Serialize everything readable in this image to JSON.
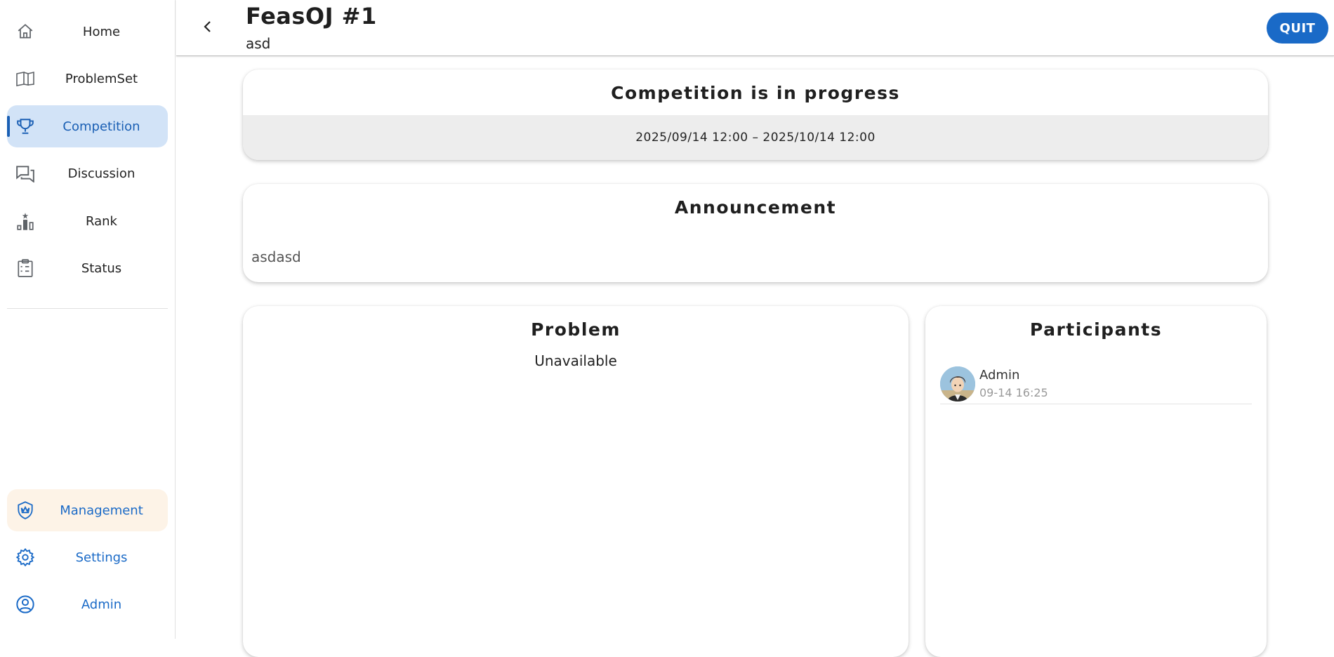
{
  "sidebar": {
    "items": [
      {
        "label": "Home",
        "icon": "home-icon"
      },
      {
        "label": "ProblemSet",
        "icon": "book-icon"
      },
      {
        "label": "Competition",
        "icon": "trophy-icon",
        "active": true
      },
      {
        "label": "Discussion",
        "icon": "forum-icon"
      },
      {
        "label": "Rank",
        "icon": "leaderboard-icon"
      },
      {
        "label": "Status",
        "icon": "clipboard-icon"
      }
    ],
    "bottom_items": [
      {
        "label": "Management",
        "icon": "shield-icon"
      },
      {
        "label": "Settings",
        "icon": "gear-icon"
      },
      {
        "label": "Admin",
        "icon": "account-icon"
      }
    ]
  },
  "header": {
    "title": "FeasOJ #1",
    "subtitle": "asd",
    "quit_label": "QUIT"
  },
  "competition": {
    "status_title": "Competition is in progress",
    "time_range": "2025/09/14 12:00 – 2025/10/14 12:00"
  },
  "announcement": {
    "title": "Announcement",
    "body": "asdasd"
  },
  "problem": {
    "title": "Problem",
    "empty_text": "Unavailable"
  },
  "participants": {
    "title": "Participants",
    "list": [
      {
        "name": "Admin",
        "joined": "09-14 16:25"
      }
    ]
  },
  "colors": {
    "accent": "#1a6ac7",
    "active_bg": "#d2e3f7",
    "management_bg": "#fdf3e7"
  }
}
